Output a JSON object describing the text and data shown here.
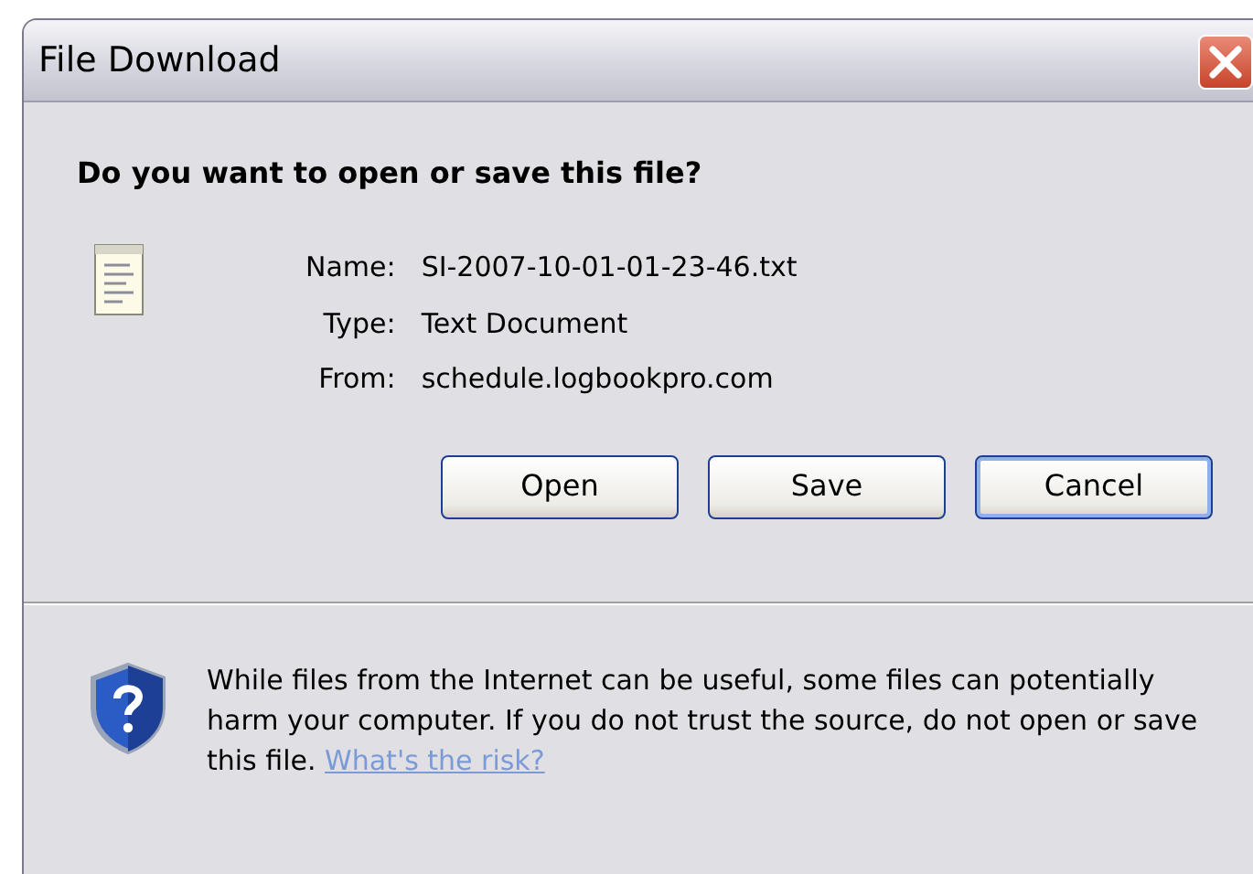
{
  "window": {
    "title": "File Download"
  },
  "question": "Do you want to open or save this file?",
  "details": [
    {
      "label": "Name:",
      "value": "SI-2007-10-01-01-23-46.txt"
    },
    {
      "label": "Type:",
      "value": "Text Document"
    },
    {
      "label": "From:",
      "value": "schedule.logbookpro.com"
    }
  ],
  "buttons": [
    {
      "label": "Open",
      "default": false
    },
    {
      "label": "Save",
      "default": false
    },
    {
      "label": "Cancel",
      "default": true
    }
  ],
  "warning": {
    "text": "While files from the Internet can be useful, some files can potentially harm your computer. If you do not trust the source, do not open or save this file.",
    "link": "What's the risk?"
  }
}
